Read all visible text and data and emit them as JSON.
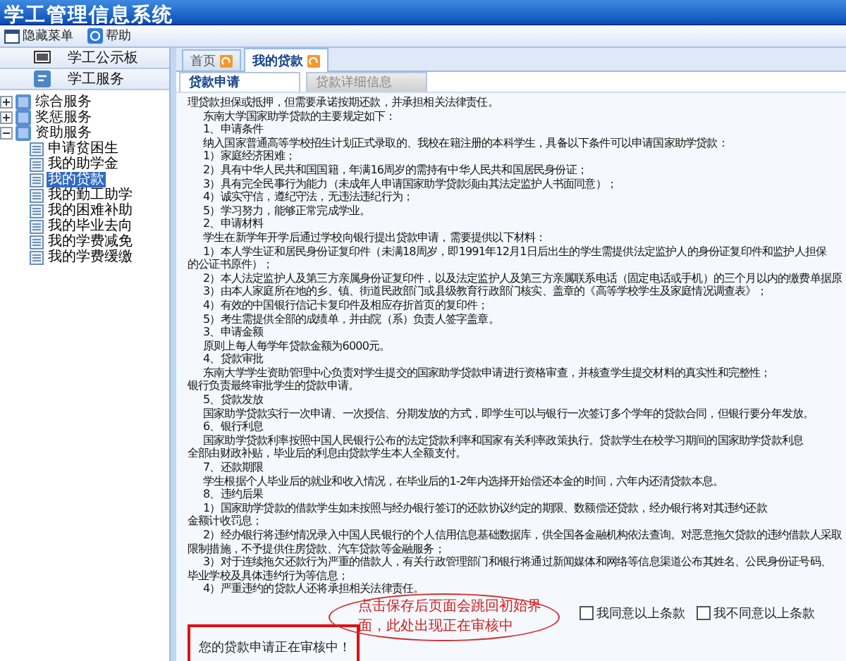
{
  "window": {
    "title": "学工管理信息系统"
  },
  "toolbar": [
    {
      "label": "隐藏菜单",
      "kind": "hide-menu"
    },
    {
      "label": "帮助",
      "kind": "help"
    }
  ],
  "sidebar": {
    "sections": [
      {
        "label": "学工公示板",
        "kind": "board"
      },
      {
        "label": "学工服务",
        "kind": "service"
      }
    ],
    "tree": [
      {
        "label": "综合服务",
        "expanded": false
      },
      {
        "label": "奖惩服务",
        "expanded": false
      },
      {
        "label": "资助服务",
        "expanded": true,
        "children": [
          {
            "label": "申请贫困生",
            "selected": false
          },
          {
            "label": "我的助学金",
            "selected": false
          },
          {
            "label": "我的贷款",
            "selected": true
          },
          {
            "label": "我的勤工助学",
            "selected": false
          },
          {
            "label": "我的困难补助",
            "selected": false
          },
          {
            "label": "我的毕业去向",
            "selected": false
          },
          {
            "label": "我的学费减免",
            "selected": false
          },
          {
            "label": "我的学费缓缴",
            "selected": false
          }
        ]
      }
    ]
  },
  "tabs": [
    {
      "label": "首页",
      "selected": false
    },
    {
      "label": "我的贷款",
      "selected": true
    }
  ],
  "subtabs": [
    {
      "label": "贷款申请",
      "selected": true
    },
    {
      "label": "贷款详细信息",
      "selected": false
    }
  ],
  "content": {
    "lines": [
      {
        "kind": "flush",
        "text": "理贷款担保或抵押，但需要承诺按期还款，并承担相关法律责任。"
      },
      {
        "kind": "indent",
        "text": "东南大学国家助学贷款的主要规定如下："
      },
      {
        "kind": "indent",
        "text": "1、申请条件"
      },
      {
        "kind": "indent",
        "text": "纳入国家普通高等学校招生计划正式录取的、我校在籍注册的本科学生，具备以下条件可以申请国家助学贷款："
      },
      {
        "kind": "indent",
        "text": "1）家庭经济困难；"
      },
      {
        "kind": "indent",
        "text": "2）具有中华人民共和国国籍，年满16周岁的需持有中华人民共和国居民身份证；"
      },
      {
        "kind": "indent",
        "text": "3）具有完全民事行为能力（未成年人申请国家助学贷款须由其法定监护人书面同意）；"
      },
      {
        "kind": "indent",
        "text": "4）诚实守信，遵纪守法，无违法违纪行为；"
      },
      {
        "kind": "indent",
        "text": "5）学习努力，能够正常完成学业。"
      },
      {
        "kind": "indent",
        "text": "2、申请材料"
      },
      {
        "kind": "indent",
        "text": "学生在新学年开学后通过学校向银行提出贷款申请，需要提供以下材料："
      },
      {
        "kind": "indent",
        "text": "1）本人学生证和居民身份证复印件（未满18周岁，即1991年12月1日后出生的学生需提供法定监护人的身份证复印件和监护人担保"
      },
      {
        "kind": "flush",
        "text": "的公证书原件）；"
      },
      {
        "kind": "indent",
        "text": "2）本人法定监护人及第三方亲属身份证复印件，以及法定监护人及第三方亲属联系电话（固定电话或手机）的三个月以内的缴费单据原"
      },
      {
        "kind": "indent",
        "text": "3）由本人家庭所在地的乡、镇、街道民政部门或县级教育行政部门核实、盖章的《高等学校学生及家庭情况调查表》；"
      },
      {
        "kind": "indent",
        "text": "4）有效的中国银行信记卡复印件及相应存折首页的复印件；"
      },
      {
        "kind": "indent",
        "text": "5）考生需提供全部的成绩单，并由院（系）负责人签字盖章。"
      },
      {
        "kind": "indent",
        "text": "3、申请金额"
      },
      {
        "kind": "indent",
        "text": "原则上每人每学年贷款金额为6000元。"
      },
      {
        "kind": "indent",
        "text": "4、贷款审批"
      },
      {
        "kind": "indent",
        "text": "东南大学学生资助管理中心负责对学生提交的国家助学贷款申请进行资格审查，并核查学生提交材料的真实性和完整性；"
      },
      {
        "kind": "flush",
        "text": "银行负责最终审批学生的贷款申请。"
      },
      {
        "kind": "indent",
        "text": "5、贷款发放"
      },
      {
        "kind": "indent",
        "text": "国家助学贷款实行一次申请、一次授信、分期发放的方式，即学生可以与银行一次签订多个学年的贷款合同，但银行要分年发放。"
      },
      {
        "kind": "indent",
        "text": "6、银行利息"
      },
      {
        "kind": "indent",
        "text": "国家助学贷款利率按照中国人民银行公布的法定贷款利率和国家有关利率政策执行。贷款学生在校学习期间的国家助学贷款利息"
      },
      {
        "kind": "flush",
        "text": "全部由财政补贴，毕业后的利息由贷款学生本人全额支付。"
      },
      {
        "kind": "indent",
        "text": "7、还款期限"
      },
      {
        "kind": "indent",
        "text": "学生根据个人毕业后的就业和收入情况，在毕业后的1-2年内选择开始偿还本金的时间，六年内还清贷款本息。"
      },
      {
        "kind": "indent",
        "text": "8、违约后果"
      },
      {
        "kind": "indent",
        "text": "1）国家助学贷款的借款学生如未按照与经办银行签订的还款协议约定的期限、数额偿还贷款，经办银行将对其违约还款"
      },
      {
        "kind": "flush",
        "text": "金额计收罚息；"
      },
      {
        "kind": "indent",
        "text": "2）经办银行将违约情况录入中国人民银行的个人信用信息基础数据库，供全国各金融机构依法查询。对恶意拖欠贷款的违约借款人采取"
      },
      {
        "kind": "flush",
        "text": "限制措施，不予提供住房贷款、汽车贷款等金融服务；"
      },
      {
        "kind": "indent",
        "text": "3）对于连续拖欠还款行为严重的借款人，有关行政管理部门和银行将通过新闻媒体和网络等信息渠道公布其姓名、公民身份证号码、"
      },
      {
        "kind": "flush",
        "text": "毕业学校及具体违约行为等信息；"
      },
      {
        "kind": "indent",
        "text": "4）严重违约的贷款人还将承担相关法律责任。"
      }
    ],
    "agreements": [
      {
        "label": "我同意以上条款",
        "checked": false
      },
      {
        "label": "我不同意以上条款",
        "checked": false
      }
    ],
    "status_message": "您的贷款申请正在审核中！"
  },
  "annotation": {
    "text": "点击保存后页面会跳回初始界面，此处出现正在审核中"
  }
}
